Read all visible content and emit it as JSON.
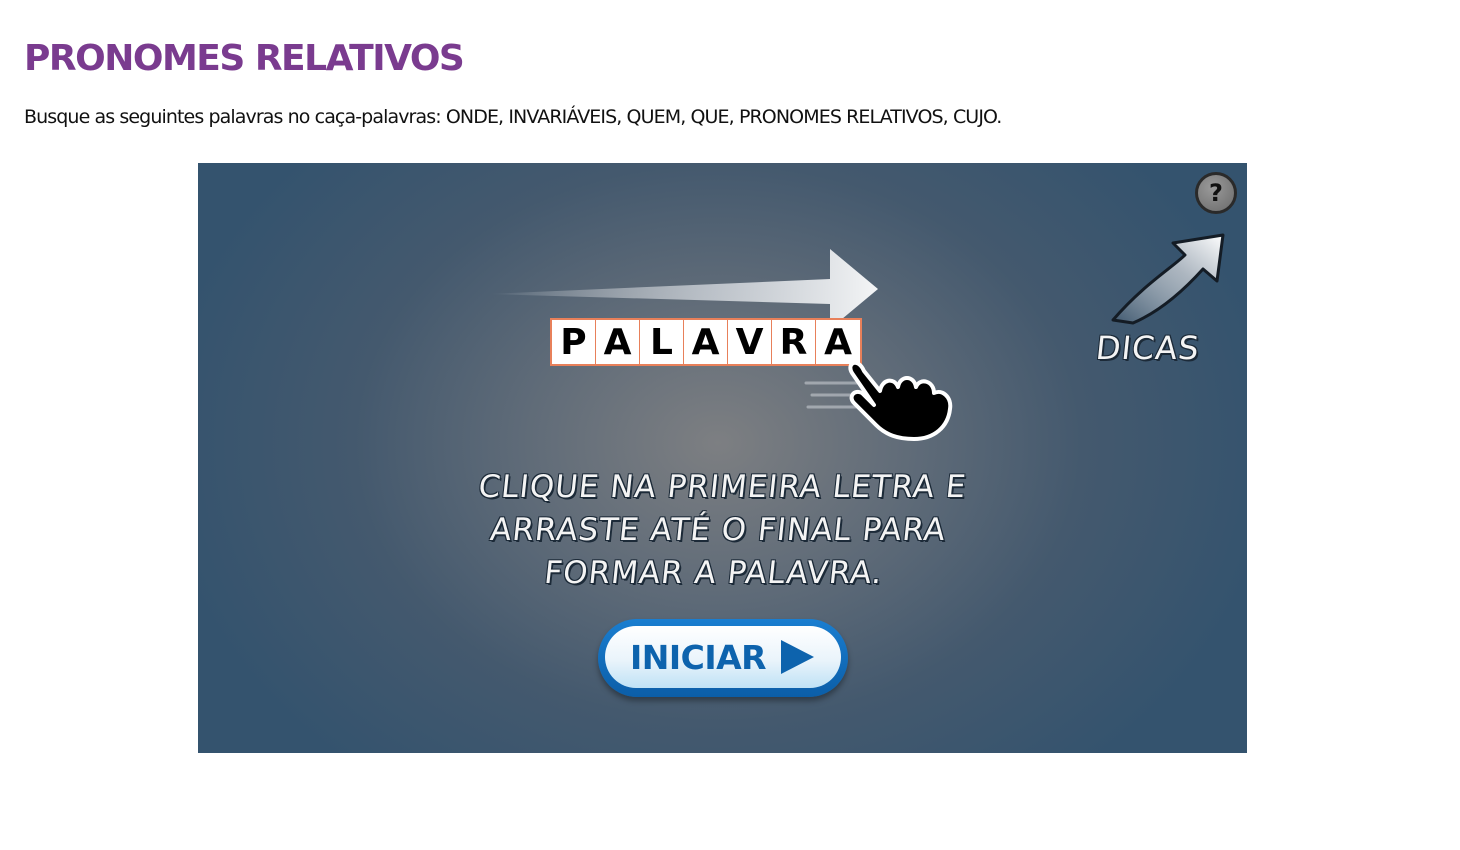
{
  "page": {
    "title": "PRONOMES RELATIVOS",
    "instructions": "Busque as seguintes palavras no caça-palavras: ONDE, INVARIÁVEIS, QUEM, QUE, PRONOMES RELATIVOS, CUJO."
  },
  "game": {
    "help_label": "?",
    "demo_letters": [
      "P",
      "A",
      "L",
      "A",
      "V",
      "R",
      "A"
    ],
    "tips_label": "DICAS",
    "instruction_lines": [
      "CLIQUE NA PRIMEIRA LETRA E",
      "ARRASTE ATÉ O FINAL PARA",
      "FORMAR A PALAVRA."
    ],
    "start_label": "INICIAR",
    "icons": [
      "help-icon",
      "swipe-arrow-icon",
      "pointing-hand-icon",
      "curved-arrow-icon",
      "play-triangle-icon"
    ]
  },
  "colors": {
    "title": "#7a3b8f",
    "letter_border": "#e8805a",
    "start_button": "#0d63ad"
  }
}
